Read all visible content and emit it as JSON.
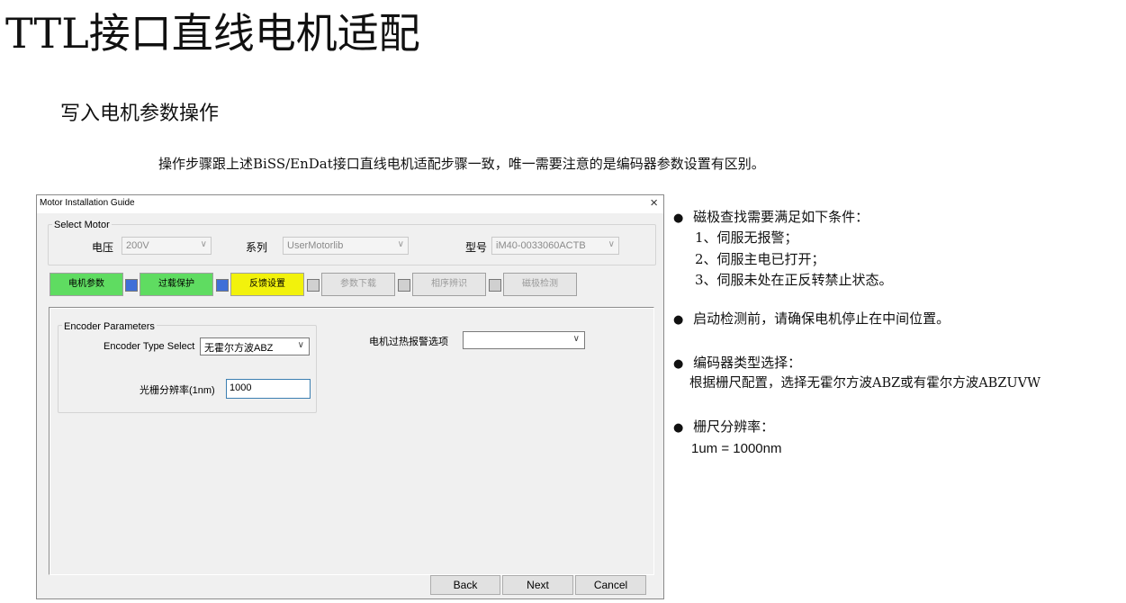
{
  "slide": {
    "title": "TTL接口直线电机适配",
    "subtitle": "写入电机参数操作",
    "intro": "操作步骤跟上述BiSS/EnDat接口直线电机适配步骤一致，唯一需要注意的是编码器参数设置有区别。"
  },
  "dialog": {
    "title": "Motor Installation Guide",
    "close_glyph": "×",
    "select_motor": {
      "legend": "Select Motor",
      "voltage_label": "电压",
      "voltage_value": "200V",
      "series_label": "系列",
      "series_value": "UserMotorlib",
      "model_label": "型号",
      "model_value": "iM40-0033060ACTB"
    },
    "steps": [
      {
        "label": "电机参数",
        "color": "#5fdc61"
      },
      {
        "label": "过载保护",
        "color": "#5fdc61"
      },
      {
        "label": "反馈设置",
        "color": "#f2f20c"
      },
      {
        "label": "参数下载",
        "color": "#e6e6e6"
      },
      {
        "label": "相序辨识",
        "color": "#e6e6e6"
      },
      {
        "label": "磁极检测",
        "color": "#e6e6e6"
      }
    ],
    "encoder": {
      "legend": "Encoder Parameters",
      "type_label": "Encoder Type Select",
      "type_value": "无霍尔方波ABZ",
      "resolution_label": "光栅分辨率(1nm)",
      "resolution_value": "1000",
      "overheat_label": "电机过热报警选项",
      "overheat_value": ""
    },
    "buttons": {
      "back": "Back",
      "next": "Next",
      "cancel": "Cancel"
    },
    "colors": {
      "step_done": "#5fdc61",
      "step_current": "#f2f20c",
      "connector_active": "#3f6fd8",
      "connector_inactive": "#d0d0d0"
    }
  },
  "notes": {
    "bullet_glyph": "●",
    "magnetic": {
      "heading": "磁极查找需要满足如下条件：",
      "items": [
        "1、伺服无报警；",
        "2、伺服主电已打开；",
        "3、伺服未处在正反转禁止状态。"
      ]
    },
    "startup": "启动检测前，请确保电机停止在中间位置。",
    "encoder_type": {
      "heading": "编码器类型选择：",
      "body": "根据栅尺配置，选择无霍尔方波ABZ或有霍尔方波ABZUVW"
    },
    "resolution": {
      "heading": "栅尺分辨率：",
      "body": "1um = 1000nm"
    }
  }
}
